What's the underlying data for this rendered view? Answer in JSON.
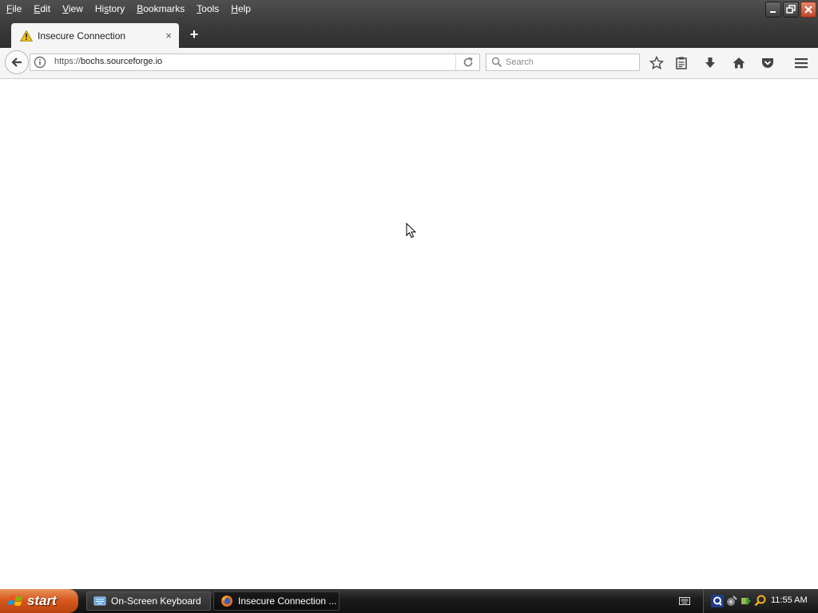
{
  "menu": {
    "items": [
      {
        "u": "F",
        "rest": "ile"
      },
      {
        "u": "E",
        "rest": "dit"
      },
      {
        "u": "V",
        "rest": "iew"
      },
      {
        "pre": "Hi",
        "u": "s",
        "rest": "tory"
      },
      {
        "u": "B",
        "rest": "ookmarks"
      },
      {
        "u": "T",
        "rest": "ools"
      },
      {
        "u": "H",
        "rest": "elp"
      }
    ]
  },
  "tab": {
    "title": "Insecure Connection",
    "close": "×",
    "new": "+"
  },
  "url": {
    "scheme": "https://",
    "host": "bochs.sourceforge.io"
  },
  "search": {
    "placeholder": "Search"
  },
  "taskbar": {
    "start": "start",
    "tasks": [
      "On-Screen Keyboard",
      "Insecure Connection ..."
    ],
    "clock": "11:55 AM"
  },
  "colors": {
    "accent": "#d65a1f",
    "warning": "#e9c21b",
    "chrome_dark": "#3a3a3a"
  }
}
